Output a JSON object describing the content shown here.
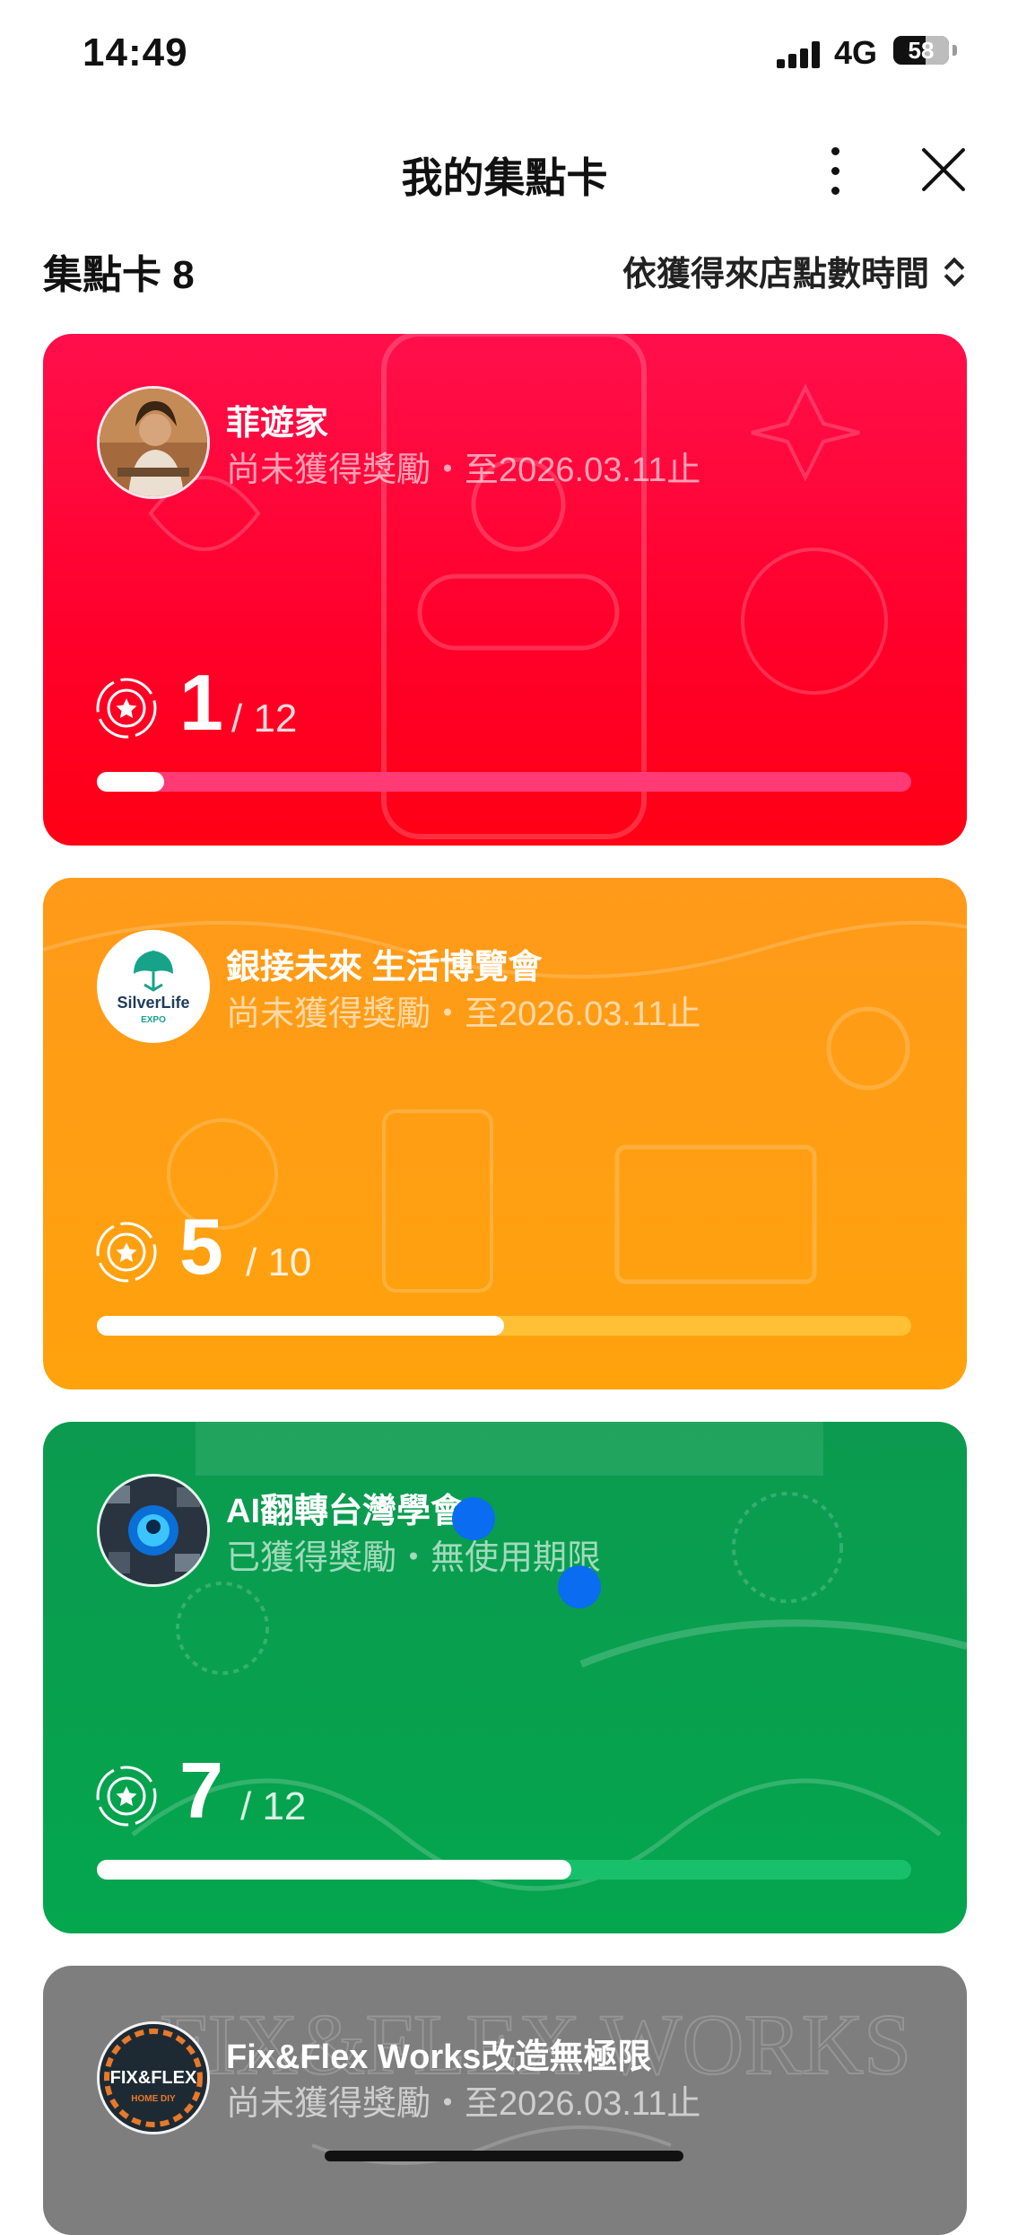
{
  "status_bar": {
    "time": "14:49",
    "network": "4G",
    "battery": "58",
    "battery_level": 0.58
  },
  "nav": {
    "title": "我的集點卡"
  },
  "summary": {
    "count_label": "集點卡 8",
    "sort_label": "依獲得來店點數時間"
  },
  "colors": {
    "red": "#ff1f3f",
    "orange": "#ff9f10",
    "green": "#0aa552",
    "gray": "#7e7e7e"
  },
  "cards": [
    {
      "title": "菲遊家",
      "subtitle": "尚未獲得獎勵・至2026.03.11止",
      "current": "1",
      "total": "/ 12",
      "progress": 0.083,
      "track": "#ff3a74"
    },
    {
      "title": "銀接未來 生活博覽會",
      "subtitle": "尚未獲得獎勵・至2026.03.11止",
      "current": "5",
      "total": "/ 10",
      "progress": 0.5,
      "track": "#ffc036",
      "logo_text": "SilverLife",
      "logo_sub": "EXPO"
    },
    {
      "title": "AI翻轉台灣學會",
      "subtitle": "已獲得獎勵・無使用期限",
      "current": "7",
      "total": "/ 12",
      "progress": 0.583,
      "track": "#19c06b"
    },
    {
      "title": "Fix&Flex Works改造無極限",
      "subtitle": "尚未獲得獎勵・至2026.03.11止",
      "logo_text": "FIX&FLEX",
      "logo_sub": "HOME DIY"
    }
  ]
}
